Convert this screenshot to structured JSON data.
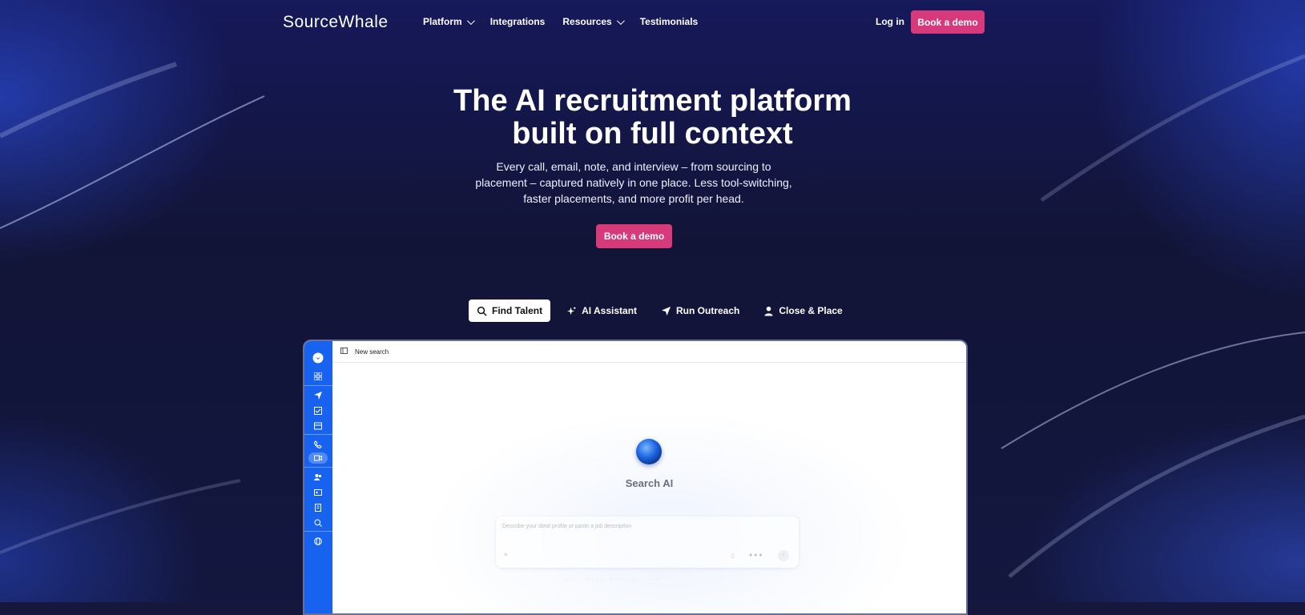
{
  "brand": {
    "name": "SourceWhale"
  },
  "nav": {
    "items": [
      {
        "label": "Platform",
        "has_dropdown": true
      },
      {
        "label": "Integrations",
        "has_dropdown": false
      },
      {
        "label": "Resources",
        "has_dropdown": true
      },
      {
        "label": "Testimonials",
        "has_dropdown": false
      }
    ],
    "login": "Log in",
    "cta": "Book a demo"
  },
  "hero": {
    "title_line1": "The AI recruitment platform",
    "title_line2": "built on full context",
    "subtitle": "Every call, email, note, and interview – from sourcing to placement – captured natively in one place. Less tool-switching, faster placements, and more profit per head.",
    "cta": "Book a demo"
  },
  "tabs": [
    {
      "label": "Find Talent",
      "icon": "search-icon",
      "active": true
    },
    {
      "label": "AI Assistant",
      "icon": "sparkle-icon",
      "active": false
    },
    {
      "label": "Run Outreach",
      "icon": "send-icon",
      "active": false
    },
    {
      "label": "Close & Place",
      "icon": "person-icon",
      "active": false
    }
  ],
  "app": {
    "topbar_title": "New search",
    "search_title": "Search AI",
    "input_placeholder": "Describe your ideal profile or paste a job description"
  },
  "colors": {
    "accent": "#d63a7a",
    "sidebar": "#1763f0",
    "background": "#15173d"
  }
}
